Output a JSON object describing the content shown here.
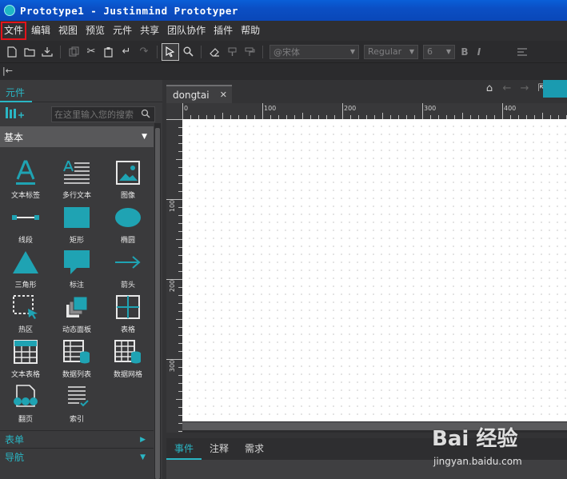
{
  "window": {
    "title": "Prototype1 - Justinmind Prototyper"
  },
  "menu": {
    "items": [
      "文件",
      "编辑",
      "视图",
      "预览",
      "元件",
      "共享",
      "团队协作",
      "插件",
      "帮助"
    ],
    "active_index": 0
  },
  "toolbar": {
    "font_name": "@宋体",
    "font_style": "Regular",
    "font_size": "6",
    "bold": "B",
    "italic": "I",
    "icons": [
      "new-file-icon",
      "open-folder-icon",
      "save-download-icon",
      "copy-icon",
      "cut-icon",
      "paste-icon",
      "undo-icon",
      "redo-icon",
      "select-arrow-icon",
      "zoom-icon",
      "eraser-icon",
      "paint-bucket-icon",
      "format-painter-icon",
      "align-icon"
    ]
  },
  "strip": {
    "collapse_symbol": "|←"
  },
  "left_panel": {
    "tab_label": "元件",
    "search_placeholder": "在这里输入您的搜索",
    "category": "基本",
    "components": [
      "文本标签",
      "多行文本",
      "图像",
      "线段",
      "矩形",
      "椭圆",
      "三角形",
      "标注",
      "箭头",
      "热区",
      "动态面板",
      "表格",
      "文本表格",
      "数据列表",
      "数据网格",
      "翻页",
      "索引"
    ],
    "sections": [
      {
        "label": "表单"
      },
      {
        "label": "导航"
      }
    ]
  },
  "workarea": {
    "doc_tab": "dongtai",
    "ruler_h": [
      "0",
      "100",
      "200",
      "300",
      "400"
    ],
    "ruler_v": [
      "100",
      "200",
      "300"
    ],
    "bottom_tabs": [
      "事件",
      "注释",
      "需求"
    ]
  },
  "colors": {
    "accent": "#2ab6c4",
    "title_bar": "#0b4fc4",
    "highlight": "#e3141b"
  },
  "watermark": {
    "brand": "Bai 经验",
    "url": "jingyan.baidu.com"
  }
}
